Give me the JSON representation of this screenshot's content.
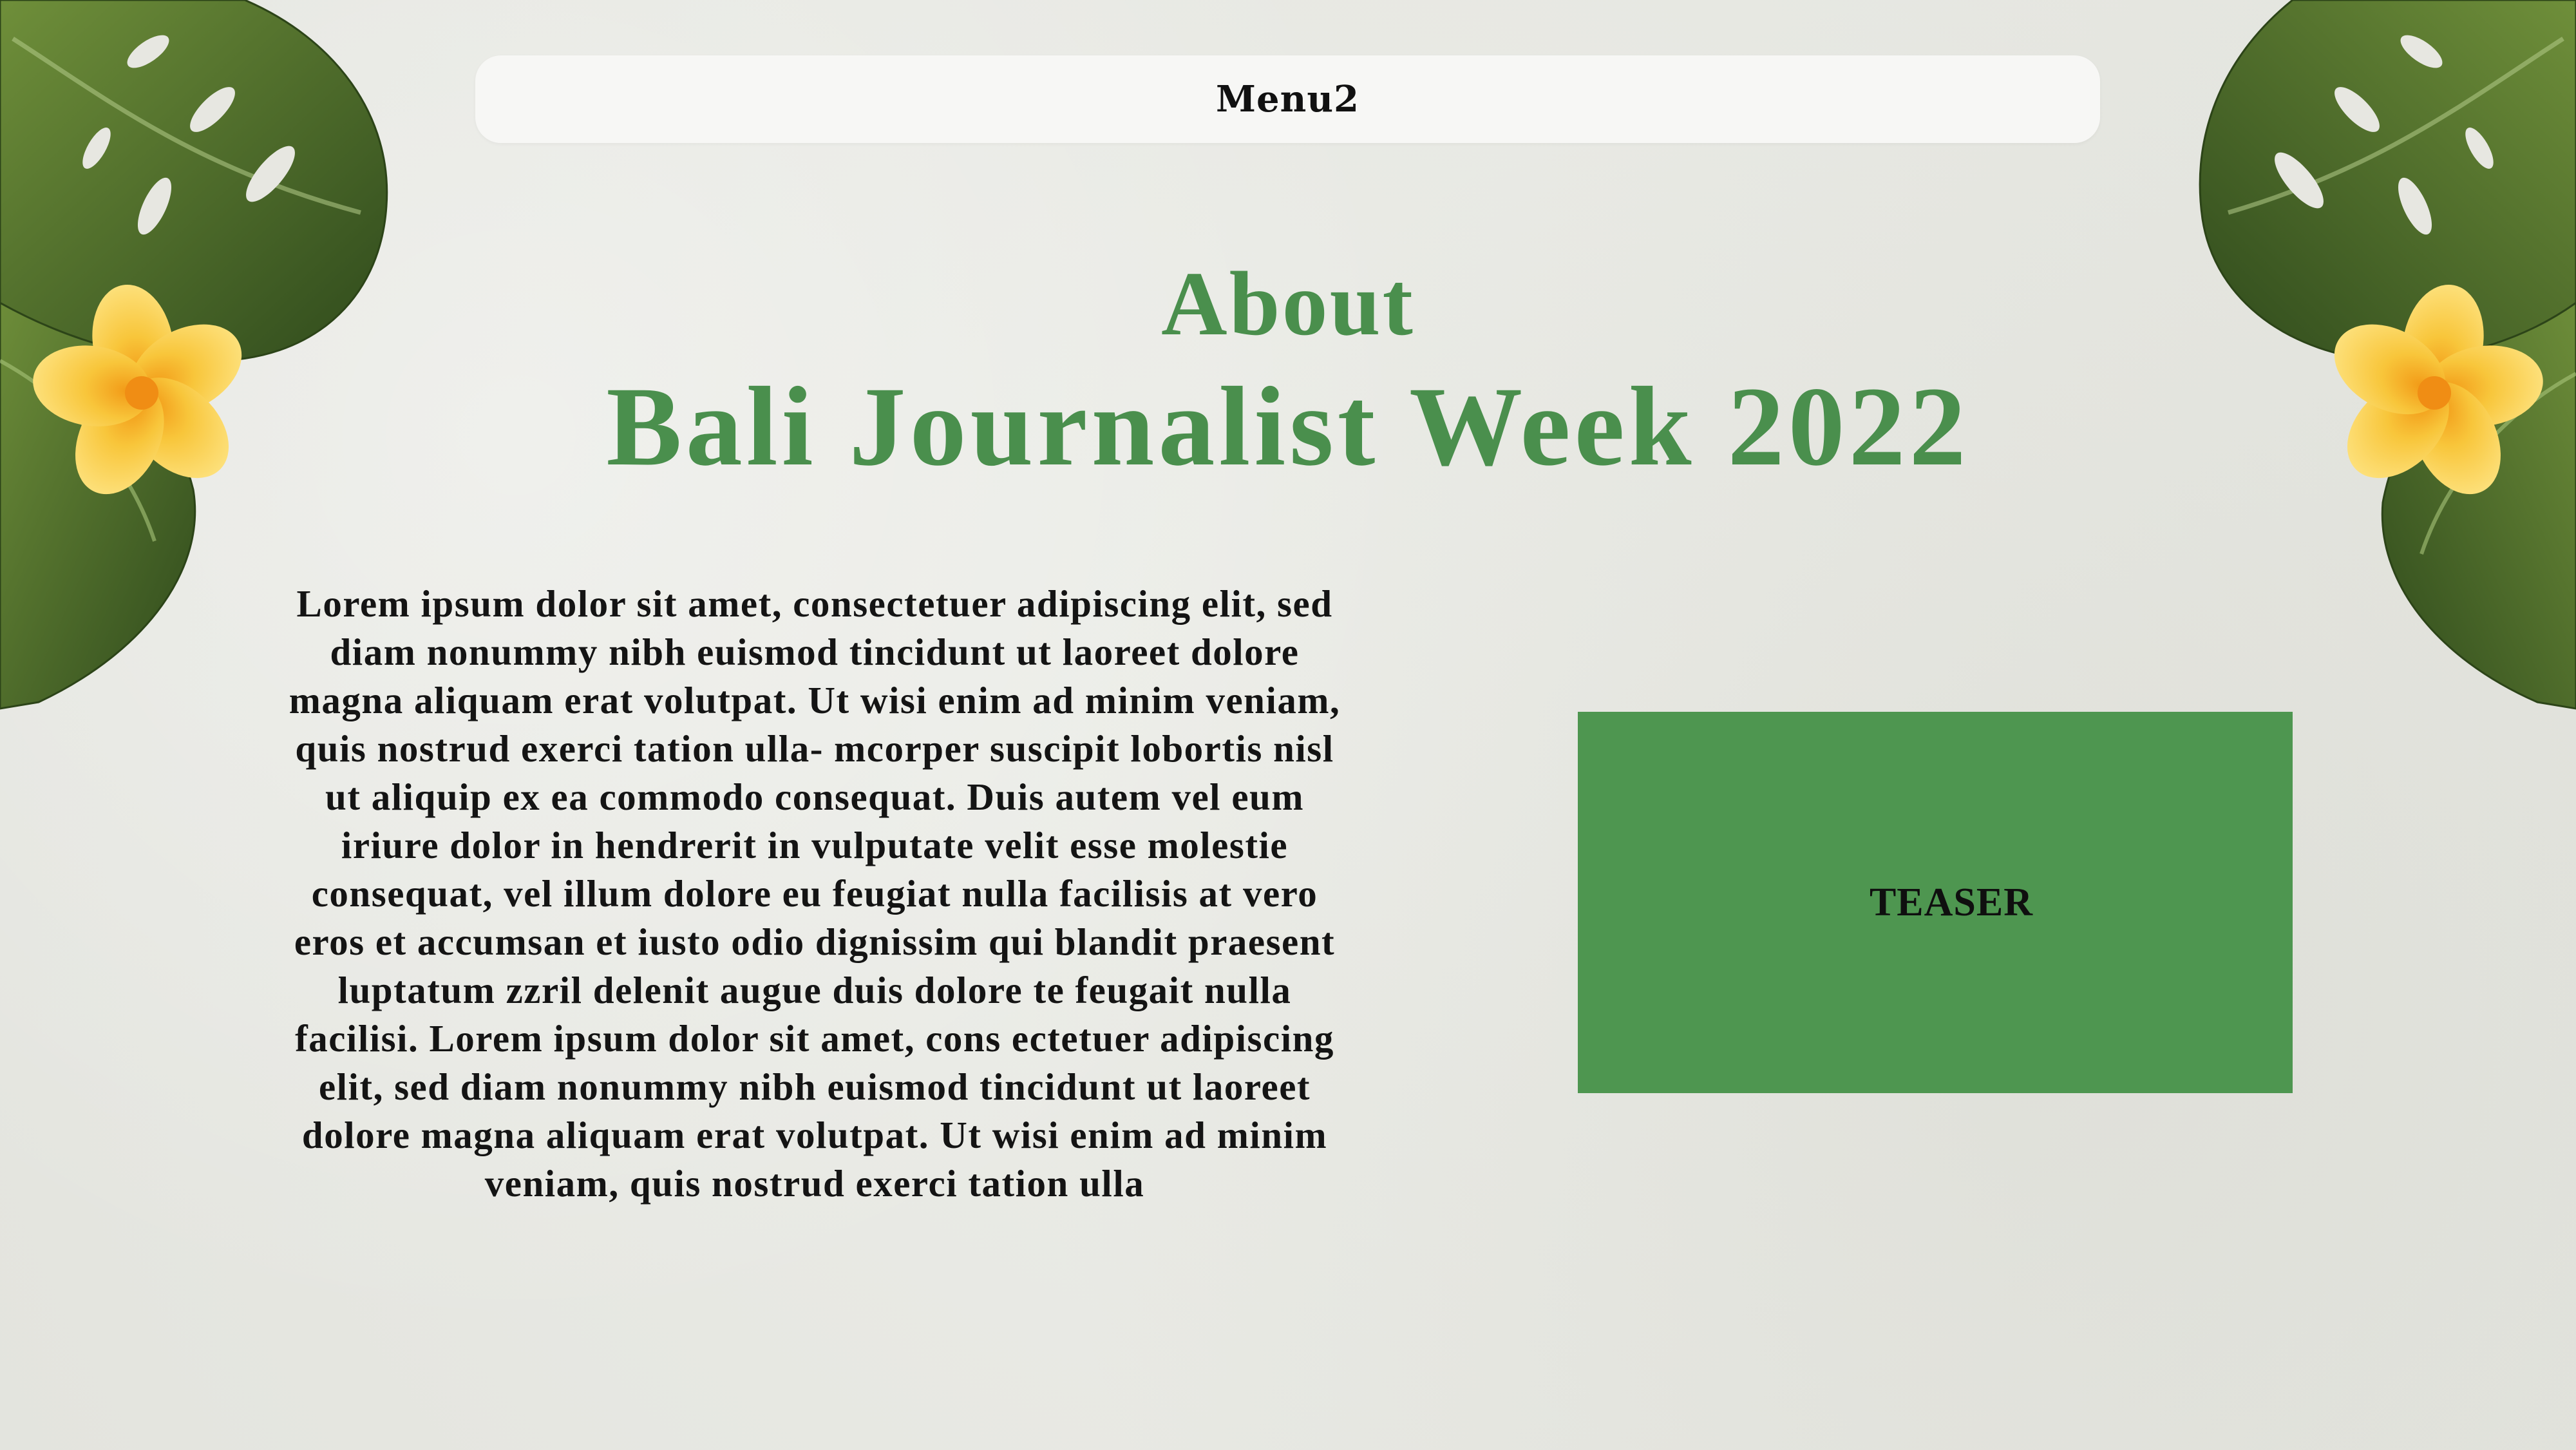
{
  "menu": {
    "label": "Menu2"
  },
  "hero": {
    "about": "About",
    "title": "Bali Journalist Week 2022"
  },
  "content": {
    "body": "Lorem ipsum dolor sit amet, consectetuer adipiscing elit, sed diam nonummy nibh euismod tincidunt ut laoreet dolore magna aliquam erat volutpat. Ut wisi enim ad minim veniam, quis nostrud exerci tation ulla- mcorper suscipit lobortis nisl ut aliquip ex ea commodo consequat. Duis autem vel eum iriure dolor in hendrerit in vulputate velit esse molestie consequat, vel illum dolore eu feugiat nulla facilisis at vero eros et accumsan et iusto odio dignissim qui blandit praesent luptatum zzril delenit augue duis dolore te feugait nulla facilisi. Lorem ipsum dolor sit amet, cons ectetuer adipiscing elit, sed diam nonummy nibh euismod tincidunt ut laoreet dolore magna aliquam erat volutpat. Ut wisi enim ad minim veniam, quis nostrud exerci tation ulla"
  },
  "teaser": {
    "label": "TEASER"
  },
  "decorations": {
    "left": "monstera-leaf-with-frangipani-icon",
    "right": "monstera-leaf-with-frangipani-icon"
  },
  "colors": {
    "background": "#e9eae4",
    "menu_bar": "#f7f7f5",
    "title_green": "#4a8f4d",
    "teaser_green": "#4e9650",
    "leaf_dark": "#3f5e25",
    "leaf_light": "#6f8f3a",
    "flower_yellow": "#f6c238",
    "flower_center": "#f29a17"
  }
}
